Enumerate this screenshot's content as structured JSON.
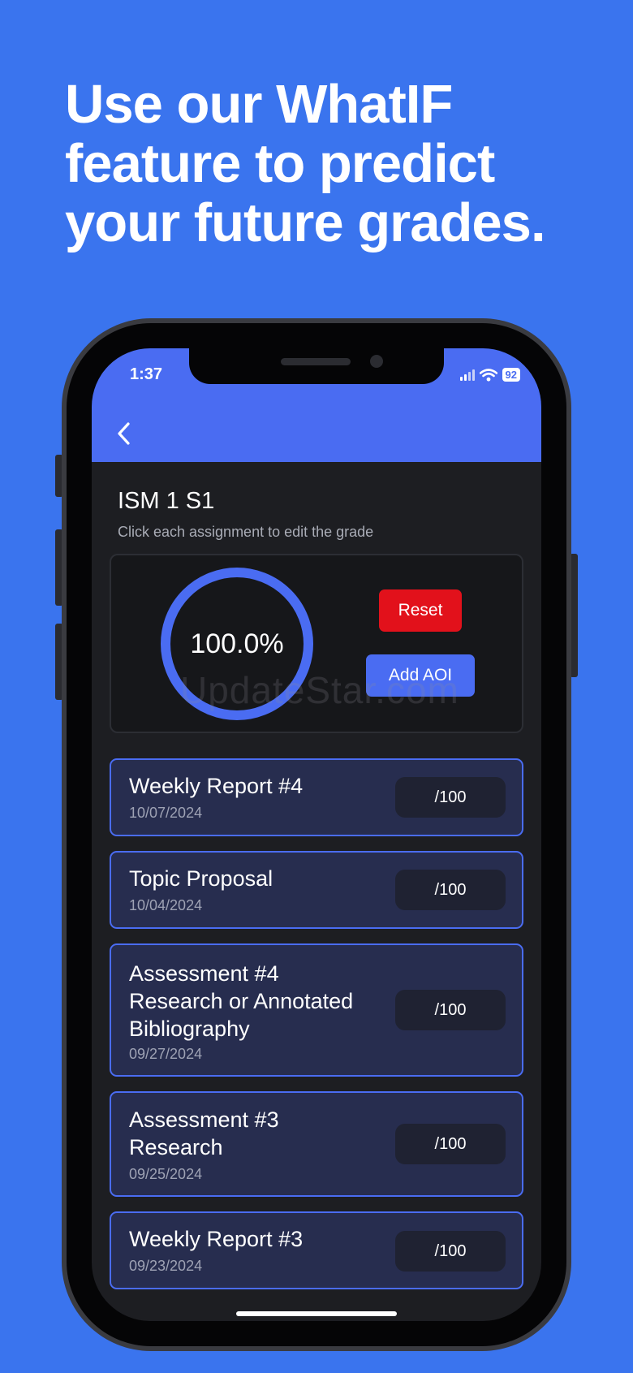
{
  "promo": {
    "headline_line1": "Use our WhatIF",
    "headline_line2": "feature to predict",
    "headline_line3": "your future grades."
  },
  "status_bar": {
    "time": "1:37",
    "battery": "92",
    "icons": [
      "signal-icon",
      "wifi-icon",
      "battery-icon"
    ]
  },
  "app_bar": {
    "back_icon": "chevron-left-icon",
    "color": "#4a6cf2"
  },
  "course": {
    "title": "ISM 1 S1",
    "subtitle": "Click each assignment to edit the grade"
  },
  "grade": {
    "value": "100.0%",
    "progress": 1.0
  },
  "actions": {
    "reset_label": "Reset",
    "add_label": "Add AOI"
  },
  "watermark": "UpdateStar.com",
  "assignments": [
    {
      "name": "Weekly Report #4",
      "date": "10/07/2024",
      "score": "/100"
    },
    {
      "name": "Topic Proposal",
      "date": "10/04/2024",
      "score": "/100"
    },
    {
      "name": "Assessment #4 Research or Annotated Bibliography",
      "date": "09/27/2024",
      "score": "/100"
    },
    {
      "name": "Assessment #3 Research",
      "date": "09/25/2024",
      "score": "/100"
    },
    {
      "name": "Weekly Report #3",
      "date": "09/23/2024",
      "score": "/100"
    }
  ],
  "colors": {
    "background": "#3a74ee",
    "accent": "#4a6cf2",
    "danger": "#e2111b",
    "card": "#272d4f"
  }
}
